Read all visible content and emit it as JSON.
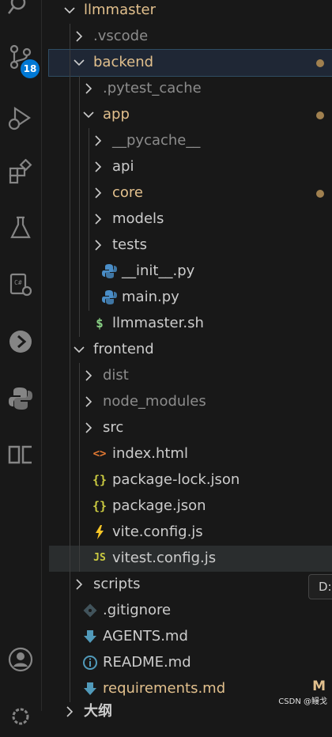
{
  "activity_bar": [
    {
      "icon": "search-icon"
    },
    {
      "icon": "source-control-icon",
      "badge": "18"
    },
    {
      "icon": "run-debug-icon"
    },
    {
      "icon": "extensions-icon"
    },
    {
      "icon": "testing-flask-icon"
    },
    {
      "icon": "remote-code-gear-icon"
    },
    {
      "icon": "gitlens-icon"
    },
    {
      "icon": "python-icon"
    },
    {
      "icon": "panel-layout-icon"
    },
    {
      "icon": "account-icon"
    },
    {
      "icon": "settings-gear-icon"
    }
  ],
  "tree": [
    {
      "label": "llmmaster",
      "depth": 0,
      "type": "folder",
      "expanded": true,
      "style": "mod"
    },
    {
      "label": ".vscode",
      "depth": 1,
      "type": "folder",
      "expanded": false,
      "style": "ign"
    },
    {
      "label": "backend",
      "depth": 1,
      "type": "folder",
      "expanded": true,
      "style": "mod",
      "dot": true,
      "active": true
    },
    {
      "label": ".pytest_cache",
      "depth": 2,
      "type": "folder",
      "expanded": false,
      "style": "ign"
    },
    {
      "label": "app",
      "depth": 2,
      "type": "folder",
      "expanded": true,
      "style": "mod",
      "dot": true
    },
    {
      "label": "__pycache__",
      "depth": 3,
      "type": "folder",
      "expanded": false,
      "style": "ign"
    },
    {
      "label": "api",
      "depth": 3,
      "type": "folder",
      "expanded": false,
      "style": "nrm"
    },
    {
      "label": "core",
      "depth": 3,
      "type": "folder",
      "expanded": false,
      "style": "mod",
      "dot": true
    },
    {
      "label": "models",
      "depth": 3,
      "type": "folder",
      "expanded": false,
      "style": "nrm"
    },
    {
      "label": "tests",
      "depth": 3,
      "type": "folder",
      "expanded": false,
      "style": "nrm"
    },
    {
      "label": "__init__.py",
      "depth": 3,
      "type": "file",
      "icon": "python-file-icon",
      "style": "nrm"
    },
    {
      "label": "main.py",
      "depth": 3,
      "type": "file",
      "icon": "python-file-icon",
      "style": "nrm"
    },
    {
      "label": "llmmaster.sh",
      "depth": 2,
      "type": "file",
      "icon": "shell-file-icon",
      "style": "nrm"
    },
    {
      "label": "frontend",
      "depth": 1,
      "type": "folder",
      "expanded": true,
      "style": "nrm"
    },
    {
      "label": "dist",
      "depth": 2,
      "type": "folder",
      "expanded": false,
      "style": "ign"
    },
    {
      "label": "node_modules",
      "depth": 2,
      "type": "folder",
      "expanded": false,
      "style": "ign"
    },
    {
      "label": "src",
      "depth": 2,
      "type": "folder",
      "expanded": false,
      "style": "nrm"
    },
    {
      "label": "index.html",
      "depth": 2,
      "type": "file",
      "icon": "html-file-icon",
      "style": "nrm"
    },
    {
      "label": "package-lock.json",
      "depth": 2,
      "type": "file",
      "icon": "json-file-icon",
      "style": "nrm"
    },
    {
      "label": "package.json",
      "depth": 2,
      "type": "file",
      "icon": "json-file-icon",
      "style": "nrm"
    },
    {
      "label": "vite.config.js",
      "depth": 2,
      "type": "file",
      "icon": "vite-file-icon",
      "style": "nrm"
    },
    {
      "label": "vitest.config.js",
      "depth": 2,
      "type": "file",
      "icon": "js-file-icon",
      "style": "nrm",
      "hover": true
    },
    {
      "label": "scripts",
      "depth": 1,
      "type": "folder",
      "expanded": false,
      "style": "nrm"
    },
    {
      "label": ".gitignore",
      "depth": 1,
      "type": "file",
      "icon": "git-file-icon",
      "style": "nrm"
    },
    {
      "label": "AGENTS.md",
      "depth": 1,
      "type": "file",
      "icon": "markdown-download-icon",
      "style": "nrm"
    },
    {
      "label": "README.md",
      "depth": 1,
      "type": "file",
      "icon": "info-file-icon",
      "style": "nrm"
    },
    {
      "label": "requirements.md",
      "depth": 1,
      "type": "file",
      "icon": "markdown-download-icon",
      "style": "mod",
      "status": "M"
    },
    {
      "label": "大纲",
      "depth": 0,
      "type": "folder",
      "expanded": false,
      "style": "nrm",
      "section": true
    }
  ],
  "tooltip": "D:",
  "watermark": "CSDN @鳗戈",
  "colors": {
    "background": "#181818",
    "modified": "#e2c08d",
    "ignored": "#8c8c8c",
    "accent": "#0078d4",
    "active_row": "#1f2735"
  }
}
